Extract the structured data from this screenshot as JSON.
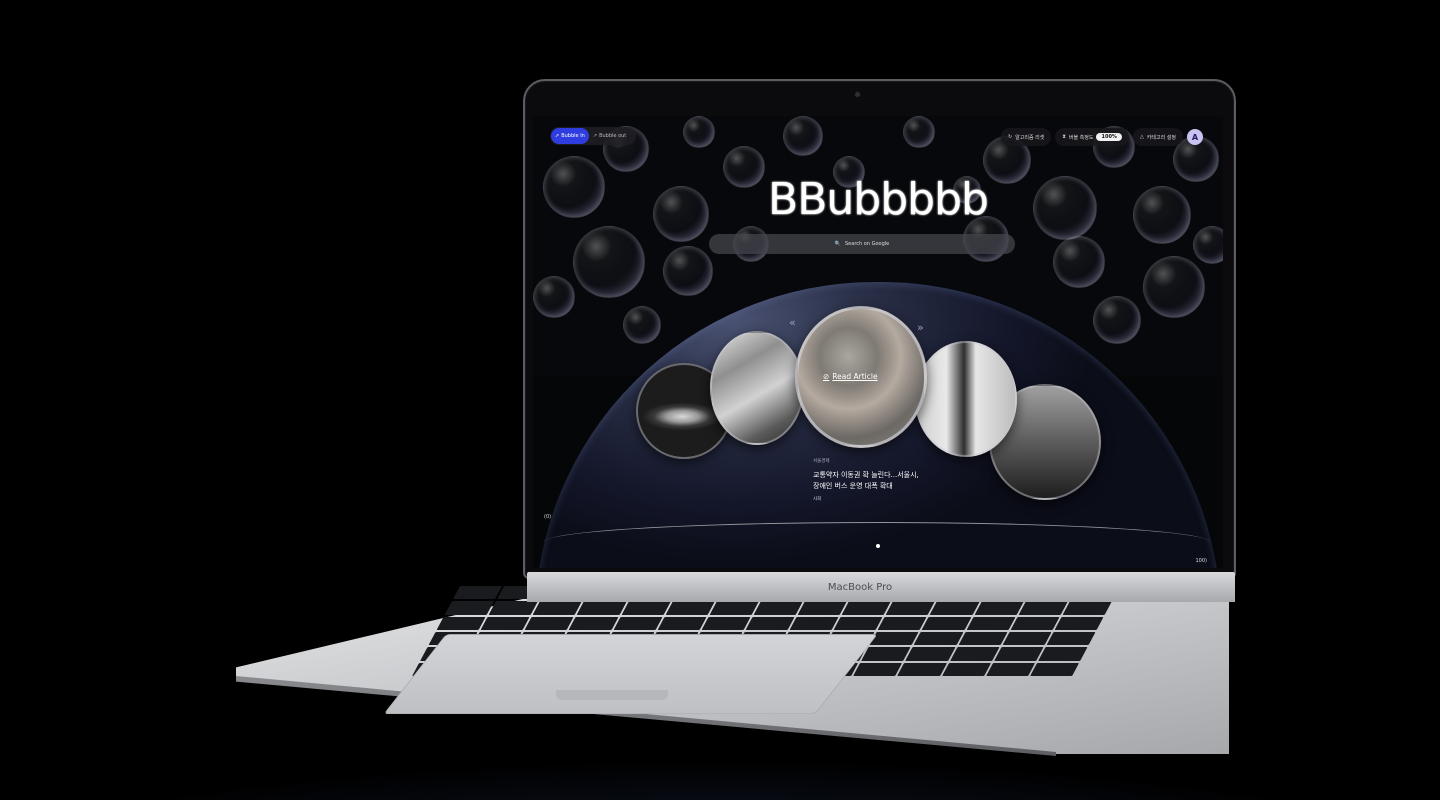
{
  "app": {
    "logo": "BBubbbbb"
  },
  "nav": {
    "mode_on": "Bubble In",
    "mode_off": "Bubble out",
    "algorithm_reset": "알고리즘 리셋",
    "bubble_density_label": "버블 측정도",
    "bubble_density_value": "100%",
    "category_settings": "카테고리 설정",
    "avatar_initial": "A"
  },
  "search": {
    "placeholder": "Search on Google"
  },
  "carousel": {
    "prev": "«",
    "next": "»",
    "read_article": "Read Article"
  },
  "article": {
    "category": "서울경제",
    "title_line1": "교통약자 이동권 확 늘린다...서울시,",
    "title_line2": "장애인 버스 운영 대폭 확대",
    "section": "사회"
  },
  "timeline": {
    "start_label": "(0)",
    "end_label": "100)"
  },
  "device": {
    "brand": "MacBook Pro"
  },
  "colors": {
    "accent": "#2f3de0",
    "avatar_bg": "#c9c3f3"
  }
}
